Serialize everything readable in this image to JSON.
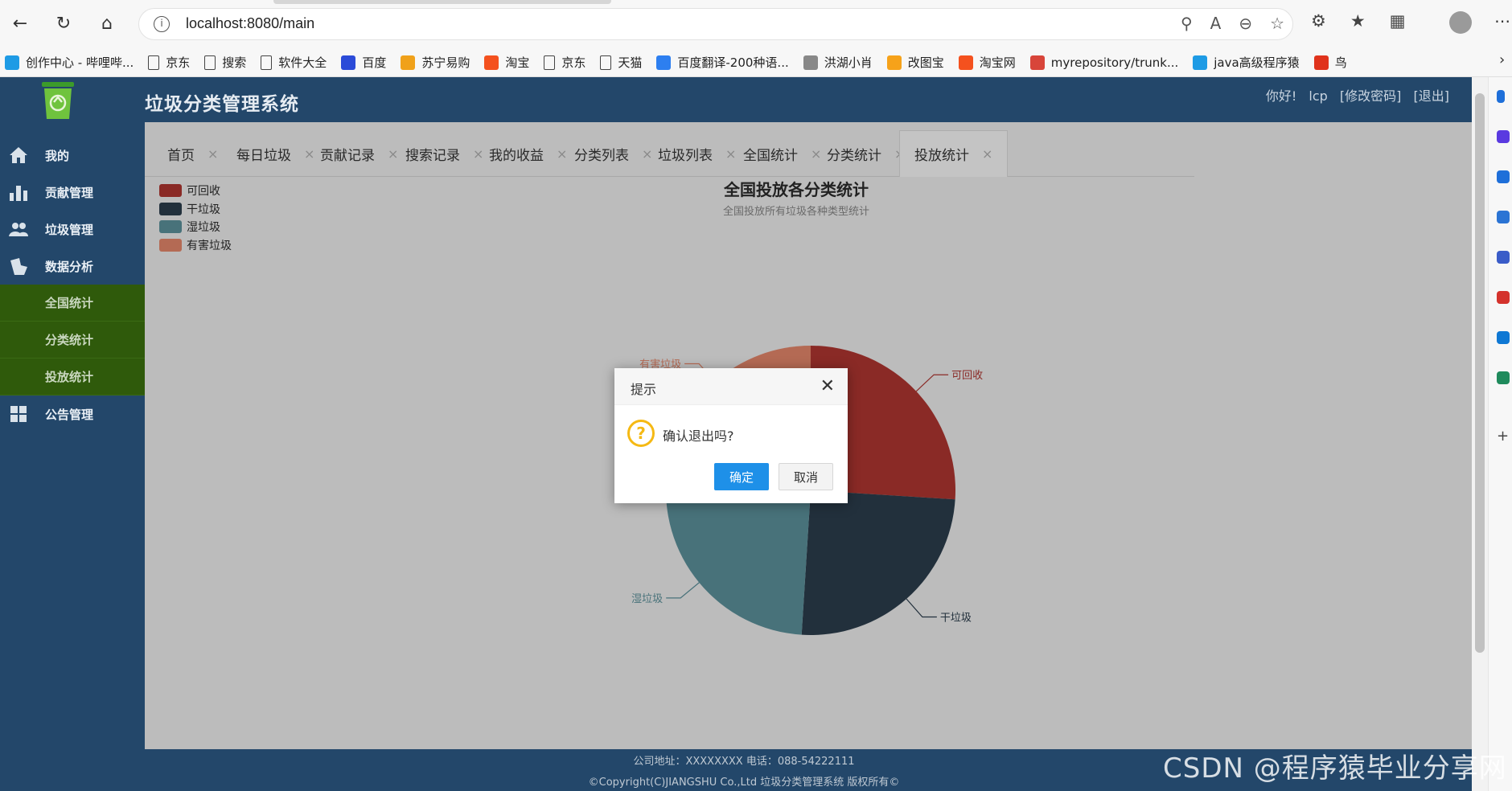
{
  "browser": {
    "url": "localhost:8080/main",
    "bookmarks": [
      {
        "label": "创作中心 - 哔哩哔...",
        "icon": "bilibili-icon",
        "color": "#1e9be5"
      },
      {
        "label": "京东",
        "icon": "page-icon"
      },
      {
        "label": "搜索",
        "icon": "page-icon"
      },
      {
        "label": "软件大全",
        "icon": "page-icon"
      },
      {
        "label": "百度",
        "icon": "baidu-icon",
        "color": "#2b4bd8"
      },
      {
        "label": "苏宁易购",
        "icon": "suning-icon",
        "color": "#f0a11a"
      },
      {
        "label": "淘宝",
        "icon": "taobao-icon",
        "color": "#f4511e"
      },
      {
        "label": "京东",
        "icon": "page-icon"
      },
      {
        "label": "天猫",
        "icon": "page-icon"
      },
      {
        "label": "百度翻译-200种语...",
        "icon": "translate-icon",
        "color": "#2d7ff0"
      },
      {
        "label": "洪湖小肖",
        "icon": "bird-icon",
        "color": "#888888"
      },
      {
        "label": "改图宝",
        "icon": "gaitubao-icon",
        "color": "#f6a21a"
      },
      {
        "label": "淘宝网",
        "icon": "taobao-icon",
        "color": "#f4511e"
      },
      {
        "label": "myrepository/trunk...",
        "icon": "chrome-icon",
        "color": "#d8453a"
      },
      {
        "label": "java高级程序猿",
        "icon": "bilibili-icon",
        "color": "#1e9be5"
      },
      {
        "label": "鸟",
        "icon": "bird-icon",
        "color": "#e0331c"
      }
    ]
  },
  "app": {
    "title": "垃圾分类管理系统",
    "user": {
      "greeting": "你好!",
      "name": "lcp",
      "change_pwd": "[修改密码]",
      "logout": "[退出]"
    },
    "sidebar": {
      "items": [
        {
          "label": "我的",
          "icon": "home-icon"
        },
        {
          "label": "贡献管理",
          "icon": "bar-chart-icon"
        },
        {
          "label": "垃圾管理",
          "icon": "users-icon"
        },
        {
          "label": "数据分析",
          "icon": "analysis-icon"
        }
      ],
      "sub_items": [
        "全国统计",
        "分类统计",
        "投放统计"
      ],
      "last_item": {
        "label": "公告管理",
        "icon": "grid-icon"
      }
    },
    "tabs": [
      {
        "label": "首页"
      },
      {
        "label": "每日垃圾"
      },
      {
        "label": "贡献记录"
      },
      {
        "label": "搜索记录"
      },
      {
        "label": "我的收益"
      },
      {
        "label": "分类列表"
      },
      {
        "label": "垃圾列表"
      },
      {
        "label": "全国统计"
      },
      {
        "label": "分类统计"
      },
      {
        "label": "投放统计"
      }
    ],
    "active_tab": "投放统计",
    "footer": {
      "line1": "公司地址：XXXXXXXX 电话：088-54222111",
      "line2": "©Copyright(C)JIANGSHU Co.,Ltd 垃圾分类管理系统 版权所有©"
    }
  },
  "chart_data": {
    "type": "pie",
    "title": "全国投放各分类统计",
    "subtitle": "全国投放所有垃圾各种类型统计",
    "legend_position": "top-left",
    "labels": [
      "可回收",
      "干垃圾",
      "湿垃圾",
      "有害垃圾"
    ],
    "values": [
      26,
      25,
      26,
      23
    ],
    "colors": [
      "#8a2a26",
      "#22303c",
      "#48727a",
      "#b46a54"
    ]
  },
  "dialog": {
    "title": "提示",
    "message": "确认退出吗?",
    "ok_label": "确定",
    "cancel_label": "取消"
  },
  "watermark": "CSDN @程序猿毕业分享网"
}
